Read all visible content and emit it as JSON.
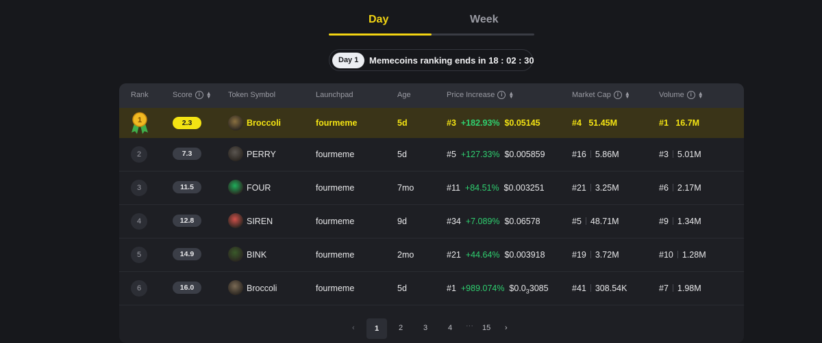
{
  "tabs": {
    "day": "Day",
    "week": "Week",
    "active_progress": 0.5
  },
  "countdown": {
    "chip": "Day 1",
    "text": "Memecoins ranking ends in 18 : 02 : 30"
  },
  "table": {
    "headers": {
      "rank": "Rank",
      "score": "Score",
      "symbol": "Token Symbol",
      "launchpad": "Launchpad",
      "age": "Age",
      "price": "Price Increase",
      "mcap": "Market Cap",
      "volume": "Volume"
    },
    "rows": [
      {
        "rank": "1",
        "score": "2.3",
        "symbol": "Broccoli",
        "launchpad": "fourmeme",
        "age": "5d",
        "price_rank": "#3",
        "price_pct": "+182.93%",
        "price": "$0.05145",
        "mcap_rank": "#4",
        "mcap": "51.45M",
        "vol_rank": "#1",
        "vol": "16.7M",
        "avatar_color": "#8a7040"
      },
      {
        "rank": "2",
        "score": "7.3",
        "symbol": "PERRY",
        "launchpad": "fourmeme",
        "age": "5d",
        "price_rank": "#5",
        "price_pct": "+127.33%",
        "price": "$0.005859",
        "mcap_rank": "#16",
        "mcap": "5.86M",
        "vol_rank": "#3",
        "vol": "5.01M",
        "avatar_color": "#5a5550"
      },
      {
        "rank": "3",
        "score": "11.5",
        "symbol": "FOUR",
        "launchpad": "fourmeme",
        "age": "7mo",
        "price_rank": "#11",
        "price_pct": "+84.51%",
        "price": "$0.003251",
        "mcap_rank": "#21",
        "mcap": "3.25M",
        "vol_rank": "#6",
        "vol": "2.17M",
        "avatar_color": "#1fae5a"
      },
      {
        "rank": "4",
        "score": "12.8",
        "symbol": "SIREN",
        "launchpad": "fourmeme",
        "age": "9d",
        "price_rank": "#34",
        "price_pct": "+7.089%",
        "price": "$0.06578",
        "mcap_rank": "#5",
        "mcap": "48.71M",
        "vol_rank": "#9",
        "vol": "1.34M",
        "avatar_color": "#d0504a"
      },
      {
        "rank": "5",
        "score": "14.9",
        "symbol": "BINK",
        "launchpad": "fourmeme",
        "age": "2mo",
        "price_rank": "#21",
        "price_pct": "+44.64%",
        "price": "$0.003918",
        "mcap_rank": "#19",
        "mcap": "3.72M",
        "vol_rank": "#10",
        "vol": "1.28M",
        "avatar_color": "#3a5a2a"
      },
      {
        "rank": "6",
        "score": "16.0",
        "symbol": "Broccoli",
        "launchpad": "fourmeme",
        "age": "5d",
        "price_rank": "#1",
        "price_pct": "+989.074%",
        "price_a": "$0.0",
        "price_sub": "3",
        "price_b": "3085",
        "mcap_rank": "#41",
        "mcap": "308.54K",
        "vol_rank": "#7",
        "vol": "1.98M",
        "avatar_color": "#7a6a55"
      }
    ]
  },
  "pagination": {
    "prev": "‹",
    "pages": [
      "1",
      "2",
      "3",
      "4"
    ],
    "ellipsis": "···",
    "last": "15",
    "next": "›"
  },
  "colors": {
    "accent": "#f3d512",
    "positive": "#2fd070",
    "background": "#17181c"
  },
  "icons": {
    "medal": "gold-medal-icon",
    "info": "info-icon",
    "sort": "sort-icon"
  }
}
